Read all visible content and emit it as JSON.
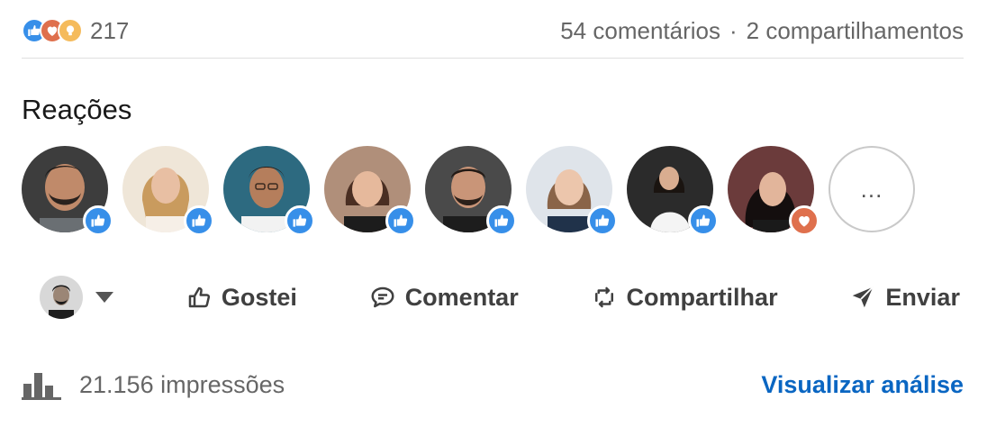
{
  "social_counts": {
    "reaction_count": "217",
    "comments": "54 comentários",
    "separator": "·",
    "shares": "2 compartilhamentos",
    "reaction_types": [
      "like",
      "love",
      "insightful"
    ]
  },
  "reactions_section": {
    "title": "Reações",
    "reactors": [
      {
        "reaction": "like"
      },
      {
        "reaction": "like"
      },
      {
        "reaction": "like"
      },
      {
        "reaction": "like"
      },
      {
        "reaction": "like"
      },
      {
        "reaction": "like"
      },
      {
        "reaction": "like"
      },
      {
        "reaction": "love"
      }
    ],
    "more_label": "..."
  },
  "actions": {
    "like": "Gostei",
    "comment": "Comentar",
    "repost": "Compartilhar",
    "send": "Enviar"
  },
  "footer": {
    "impressions": "21.156 impressões",
    "analytics_link": "Visualizar análise"
  },
  "colors": {
    "like": "#378fe9",
    "love": "#df704d",
    "insightful": "#f5bb5c",
    "link": "#0a66c2",
    "muted_text": "#666666"
  }
}
